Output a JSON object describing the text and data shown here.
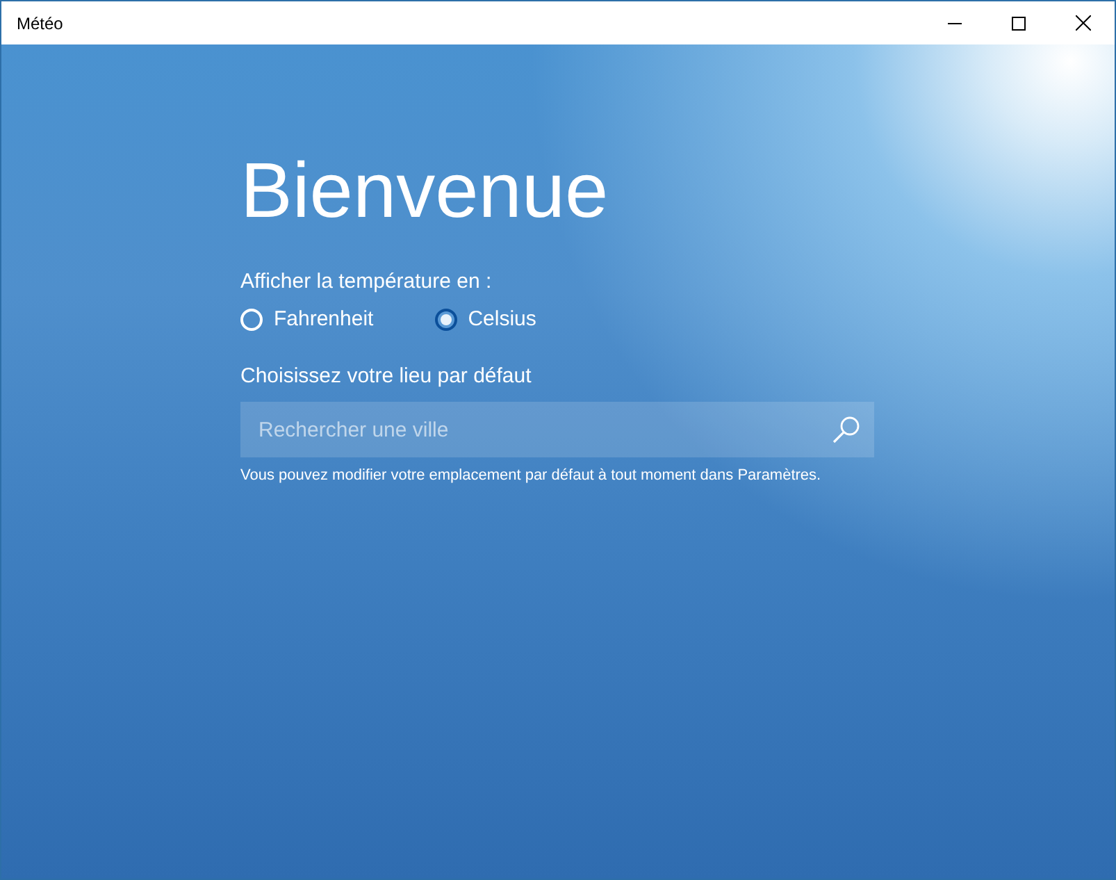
{
  "window": {
    "title": "Météo"
  },
  "heading": "Bienvenue",
  "temperature": {
    "label": "Afficher la température en :",
    "options": [
      {
        "label": "Fahrenheit",
        "selected": false
      },
      {
        "label": "Celsius",
        "selected": true
      }
    ]
  },
  "location": {
    "label": "Choisissez votre lieu par défaut",
    "search": {
      "placeholder": "Rechercher une ville"
    },
    "hint": "Vous pouvez modifier votre emplacement par défaut à tout moment dans Paramètres."
  }
}
